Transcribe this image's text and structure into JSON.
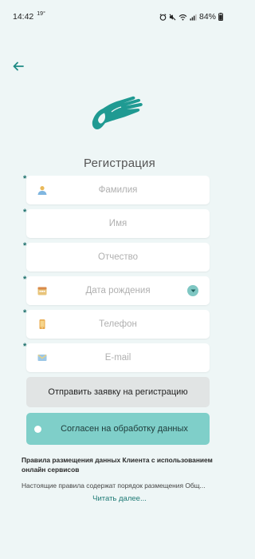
{
  "status_bar": {
    "time": "14:42",
    "temperature": "19°",
    "battery": "84%"
  },
  "icons": {
    "back": "arrow-left-icon",
    "logo": "hand-logo-icon",
    "person": "person-icon",
    "calendar": "calendar-icon",
    "phone": "phone-icon",
    "email": "email-icon",
    "dropdown": "chevron-down-icon"
  },
  "colors": {
    "accent": "#1f9a92",
    "background": "#eef6f6",
    "toggle_bg": "#7fcfc9",
    "link": "#1f7b76"
  },
  "page": {
    "title": "Регистрация"
  },
  "form": {
    "required_mark": "*",
    "fields": [
      {
        "name": "surname",
        "placeholder": "Фамилия",
        "value": ""
      },
      {
        "name": "name",
        "placeholder": "Имя",
        "value": ""
      },
      {
        "name": "patronymic",
        "placeholder": "Отчество",
        "value": ""
      },
      {
        "name": "birthdate",
        "placeholder": "Дата рождения",
        "value": ""
      },
      {
        "name": "phone",
        "placeholder": "Телефон",
        "value": ""
      },
      {
        "name": "email",
        "placeholder": "E-mail",
        "value": ""
      }
    ],
    "submit_label": "Отправить заявку на регистрацию",
    "consent_label": "Согласен на обработку данных",
    "consent_checked": false
  },
  "rules": {
    "title": "Правила размещения данных Клиента с использованием онлайн сервисов",
    "text": "Настоящие правила содержат порядок размещения Общ...",
    "read_more": "Читать далее..."
  }
}
